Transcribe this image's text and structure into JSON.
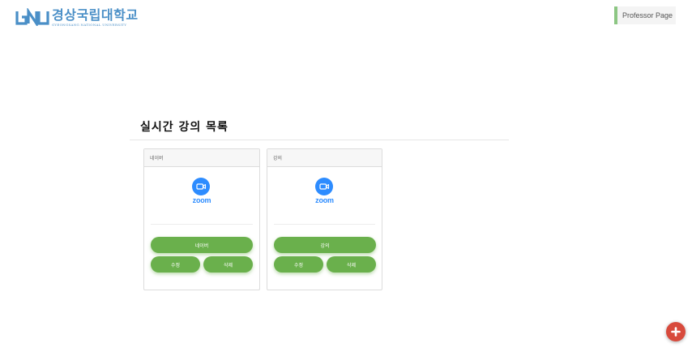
{
  "header": {
    "logo": {
      "name_kr": "경상국립대학교",
      "name_en": "Gyeongsang National University",
      "color": "#4a8fc7"
    },
    "professor_link": {
      "label": "Professor Page",
      "accent": "#8cc683"
    }
  },
  "section": {
    "title": "실시간 강의 목록"
  },
  "lectures": [
    {
      "title": "네이버",
      "platform": "zoom",
      "enter_label": "네이버",
      "edit_label": "수정",
      "delete_label": "삭제"
    },
    {
      "title": "강의",
      "platform": "zoom",
      "enter_label": "강의",
      "edit_label": "수정",
      "delete_label": "삭제"
    }
  ],
  "fab": {
    "icon": "plus-icon",
    "color": "#d84a3c"
  },
  "colors": {
    "button": "#6ab04c",
    "zoom": "#2d8cff"
  }
}
